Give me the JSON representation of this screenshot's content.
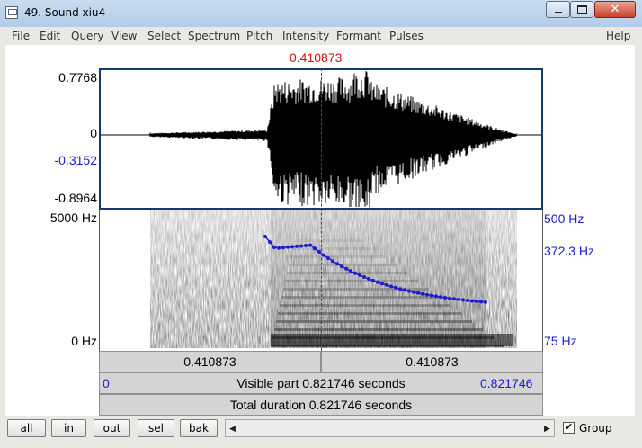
{
  "window": {
    "title": "49. Sound xiu4"
  },
  "menu": [
    "File",
    "Edit",
    "Query",
    "View",
    "Select",
    "Spectrum",
    "Pitch",
    "Intensity",
    "Formant",
    "Pulses",
    "Help"
  ],
  "cursor": {
    "time": "0.410873"
  },
  "waveform": {
    "y_max": "0.7768",
    "y_zero": "0",
    "y_marker": "-0.3152",
    "y_min": "-0.8964"
  },
  "spectrogram": {
    "freq_max": "5000 Hz",
    "freq_min": "0 Hz",
    "pitch_max": "500 Hz",
    "pitch_value": "372.3 Hz",
    "pitch_min": "75 Hz"
  },
  "timebar": {
    "left_segment": "0.410873",
    "right_segment": "0.410873",
    "start": "0",
    "visible": "Visible part 0.821746 seconds",
    "end": "0.821746",
    "total": "Total duration 0.821746 seconds"
  },
  "buttons": {
    "all": "all",
    "in": "in",
    "out": "out",
    "sel": "sel",
    "bak": "bak"
  },
  "group": {
    "label": "Group",
    "checked": true
  },
  "colors": {
    "cursor": "#cc1111",
    "pitch": "#1c1cd0",
    "frame": "#123b6d"
  }
}
